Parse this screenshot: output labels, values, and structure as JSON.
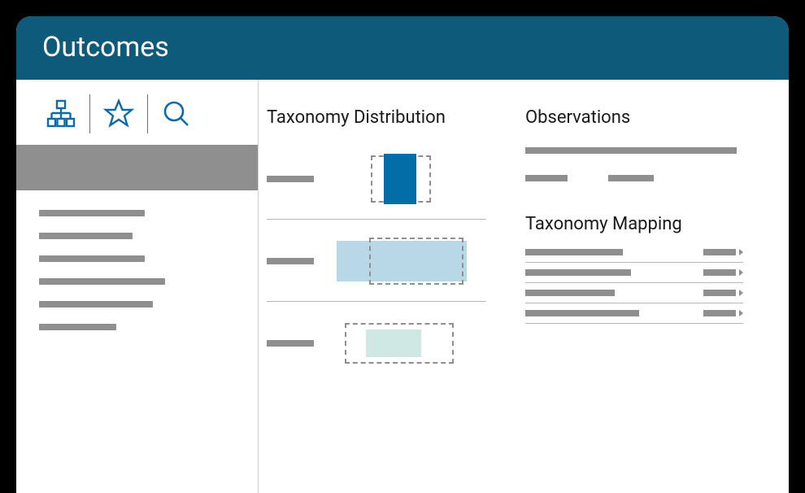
{
  "header": {
    "title": "Outcomes"
  },
  "sidebar": {
    "tabs": [
      {
        "name": "hierarchy-icon"
      },
      {
        "name": "star-icon"
      },
      {
        "name": "search-icon"
      }
    ]
  },
  "sections": {
    "taxonomy_distribution": {
      "title": "Taxonomy Distribution"
    },
    "observations": {
      "title": "Observations"
    },
    "taxonomy_mapping": {
      "title": "Taxonomy Mapping"
    }
  },
  "colors": {
    "accent": "#0d6aa8",
    "header_bg": "#0d5a7a",
    "bar_dark": "#036da8",
    "bar_mid": "#b8d8e8",
    "bar_light": "#cfe8e4",
    "gray": "#8f8f8f"
  }
}
